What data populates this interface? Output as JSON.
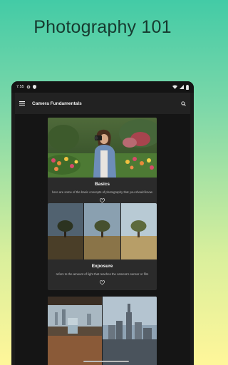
{
  "promo": {
    "title": "Photography 101"
  },
  "status_bar": {
    "time": "7:55"
  },
  "app_bar": {
    "title": "Camera Fundamentals",
    "menu_icon": "menu-icon",
    "search_icon": "search-icon"
  },
  "cards": [
    {
      "title": "Basics",
      "description": "here are some of the basic concepts of photography that you should know",
      "image": "woman-with-camera-in-garden",
      "favorite_icon": "heart-outline-icon"
    },
    {
      "title": "Exposure",
      "description": "refers to the amount of light that reaches the camera's sensor or film",
      "image": "tree-in-field-three-exposures",
      "favorite_icon": "heart-outline-icon"
    },
    {
      "title": "",
      "description": "",
      "image": "glass-and-city-skyline"
    }
  ],
  "colors": {
    "device_bg": "#1b1b1b",
    "app_bar_bg": "#222222",
    "card_bg": "#2b2b2b",
    "text_primary": "#ffffff",
    "text_secondary": "#bdbdbd"
  }
}
